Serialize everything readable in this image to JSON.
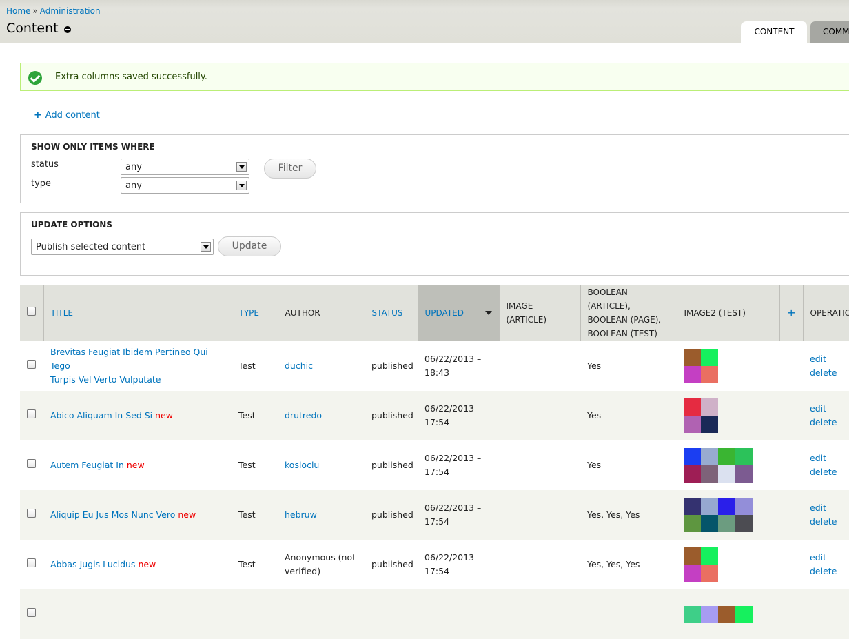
{
  "breadcrumb": {
    "home": "Home",
    "separator": "»",
    "admin": "Administration"
  },
  "page": {
    "title": "Content"
  },
  "tabs": [
    {
      "label": "CONTENT"
    },
    {
      "label": "COMM"
    }
  ],
  "message": {
    "text": "Extra columns saved successfully."
  },
  "actions": {
    "add_content": "Add content",
    "add_icon": "+"
  },
  "filters": {
    "legend": "SHOW ONLY ITEMS WHERE",
    "status_label": "status",
    "status_value": "any",
    "type_label": "type",
    "type_value": "any",
    "filter_button": "Filter"
  },
  "update_options": {
    "legend": "UPDATE OPTIONS",
    "operation_value": "Publish selected content",
    "update_button": "Update"
  },
  "table": {
    "headers": {
      "title": "TITLE",
      "type": "TYPE",
      "author": "AUTHOR",
      "status": "STATUS",
      "updated": "UPDATED",
      "image_article": "IMAGE (ARTICLE)",
      "boolean_1": "BOOLEAN (ARTICLE),",
      "boolean_2": "BOOLEAN (PAGE),",
      "boolean_3": "BOOLEAN (TEST)",
      "image2": "IMAGE2 (TEST)",
      "add_col": "+",
      "operations": "OPERATIO"
    },
    "rows": [
      {
        "title1": "Brevitas Feugiat Ibidem Pertineo Qui Tego",
        "title2": "Turpis Vel Verto Vulputate",
        "new": "",
        "type": "Test",
        "author1": "duchic",
        "author2": "",
        "author_link": true,
        "status": "published",
        "date": "06/22/2013 –",
        "time": "18:43",
        "boolean": "Yes",
        "thumb_cols": 2,
        "thumbs": [
          "#9b5c2c",
          "#16f05e",
          "#c43fc3",
          "#ea6f62"
        ],
        "edit": "edit",
        "delete": "delete"
      },
      {
        "title1": "Abico Aliquam In Sed Si",
        "title2": "",
        "new": "new",
        "type": "Test",
        "author1": "drutredo",
        "author2": "",
        "author_link": true,
        "status": "published",
        "date": "06/22/2013 –",
        "time": "17:54",
        "boolean": "Yes",
        "thumb_cols": 2,
        "thumbs": [
          "#e52b41",
          "#cfb1c8",
          "#b062b2",
          "#1a2957"
        ],
        "edit": "edit",
        "delete": "delete"
      },
      {
        "title1": "Autem Feugiat In",
        "title2": "",
        "new": "new",
        "type": "Test",
        "author1": "kosloclu",
        "author2": "",
        "author_link": true,
        "status": "published",
        "date": "06/22/2013 –",
        "time": "17:54",
        "boolean": "Yes",
        "thumb_cols": 4,
        "thumbs": [
          "#1b3ef2",
          "#98abd0",
          "#3ab532",
          "#2cc25a",
          "#9e1e55",
          "#7e6279",
          "#dbe1f0",
          "#7c5b91"
        ],
        "edit": "edit",
        "delete": "delete"
      },
      {
        "title1": "Aliquip Eu Jus Mos Nunc Vero",
        "title2": "",
        "new": "new",
        "type": "Test",
        "author1": "hebruw",
        "author2": "",
        "author_link": true,
        "status": "published",
        "date": "06/22/2013 –",
        "time": "17:54",
        "boolean": "Yes, Yes, Yes",
        "thumb_cols": 4,
        "thumbs": [
          "#343270",
          "#96a8d0",
          "#2a1fea",
          "#938ed9",
          "#5e9640",
          "#05556a",
          "#6c9c80",
          "#4c4c52"
        ],
        "edit": "edit",
        "delete": "delete"
      },
      {
        "title1": "Abbas Jugis Lucidus",
        "title2": "",
        "new": "new",
        "type": "Test",
        "author1": "Anonymous (not",
        "author2": "verified)",
        "author_link": false,
        "status": "published",
        "date": "06/22/2013 –",
        "time": "17:54",
        "boolean": "Yes, Yes, Yes",
        "thumb_cols": 2,
        "thumbs": [
          "#9b5c2c",
          "#16f05e",
          "#c43fc3",
          "#ea6f62"
        ],
        "edit": "edit",
        "delete": "delete"
      },
      {
        "title1": "",
        "title2": "",
        "new": "",
        "type": "",
        "author1": "",
        "author2": "",
        "author_link": true,
        "status": "",
        "date": "",
        "time": "",
        "boolean": "",
        "thumb_cols": 4,
        "thumbs": [
          "#3ecf88",
          "#a79cf2",
          "#9b5c2c",
          "#16f05e"
        ],
        "edit": "",
        "delete": ""
      }
    ]
  }
}
